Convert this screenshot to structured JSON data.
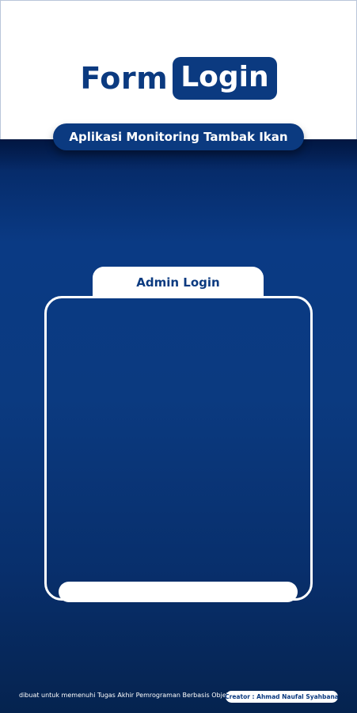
{
  "header": {
    "title_word1": "Form",
    "title_word2": "Login",
    "app_name": "Aplikasi Monitoring Tambak Ikan"
  },
  "login_panel": {
    "tab_label": "Admin Login"
  },
  "footer": {
    "note": "dibuat untuk memenuhi Tugas Akhir Pemrograman Berbasis Objek",
    "creator": "Creator : Ahmad Naufal Syahbana"
  },
  "colors": {
    "primary_blue": "#0b3a80",
    "dark_blue": "#04255f",
    "white": "#ffffff"
  }
}
